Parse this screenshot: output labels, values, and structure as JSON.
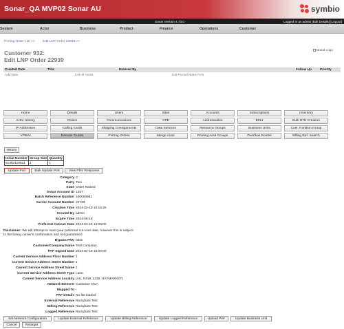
{
  "header": {
    "title": "Sonar_QA MVP02 Sonar AU",
    "logo_text": "symbio",
    "bg_color": "#b32a2e"
  },
  "topbar": {
    "version": "Sonar Version 4.73.0",
    "user_text": "Logged in as admin [Edit Details] [Logout]"
  },
  "menu": [
    "System",
    "Actor",
    "Business",
    "Product",
    "Finance",
    "Operations",
    "Customer"
  ],
  "breadcrumbs": [
    "Porting Order List >>",
    "Edit LNP Order 22939 >>"
  ],
  "page": {
    "title_line1": "Customer 932:",
    "title_line2": "Edit LNP Order 22939",
    "brand_logo_alt": "Brand Logo"
  },
  "notes_grid": {
    "headers": [
      "Created Date",
      "Title",
      "Entered By",
      "Follow Up",
      "Priority"
    ],
    "links": [
      "Add Note",
      "List All Notes",
      "List Pinned Notes First"
    ]
  },
  "nav_buttons": [
    [
      "Home",
      "Details",
      "Users",
      "Sites",
      "Accounts",
      "Subscriptions",
      "Inventory"
    ],
    [
      "Actor History",
      "Orders",
      "Communications",
      "CPE",
      "Addressables",
      "E911",
      "Bulk RTE Creation"
    ],
    [
      "IP Addresses",
      "Calling Cards",
      "Shipping Consignments",
      "Data Services",
      "Resource Groups",
      "Business Units",
      "Cust. Partition Group"
    ],
    [
      "VPBXs",
      "Remote Trunks",
      "Porting Orders",
      "Merge Actor",
      "Routing Area Groups",
      "Overflow Routes",
      "Billing Ref. Search"
    ]
  ],
  "history_button": "History",
  "number_table": {
    "headers": [
      "Initial Number",
      "Group Size",
      "Quantity"
    ],
    "rows": [
      [
        "61352110511",
        "1",
        "1"
      ]
    ]
  },
  "port_buttons": [
    "Update Port",
    "Bulk Update Port",
    "View PNV Response"
  ],
  "details": [
    {
      "label": "Category",
      "value": "C"
    },
    {
      "label": "Party",
      "value": "Two"
    },
    {
      "label": "State",
      "value": "Order Raised"
    },
    {
      "label": "Sonar Account ID",
      "value": "1387"
    },
    {
      "label": "Batch Reference Number",
      "value": "100069951"
    },
    {
      "label": "Carrier Account Number",
      "value": "20733"
    },
    {
      "label": "Creation Time",
      "value": "2024-02-19 10:16:25"
    },
    {
      "label": "Created By",
      "value": "admin"
    },
    {
      "label": "Expire Time",
      "value": "2024-06-18"
    },
    {
      "label": "Preferred Cutover Date",
      "value": "2024-03-13 13:00:00"
    }
  ],
  "disclaimer": {
    "label": "Disclaimer:",
    "text": "We will attempt to meet your preferred cut-over date, however this is subject to the losing carrier's confirmation and not guaranteed"
  },
  "details2": [
    {
      "label": "Bypass PNV",
      "value": "false"
    },
    {
      "label": "Customer/Company Name",
      "value": "Test Company"
    },
    {
      "label": "PAF Signed Date",
      "value": "2024-02-19 15:00:00"
    },
    {
      "label": "Current Service Address Floor Number",
      "value": "1"
    },
    {
      "label": "Current Service Address Street Number",
      "value": "1"
    },
    {
      "label": "Current Service Address Street Name",
      "value": "1"
    },
    {
      "label": "Current Service Address Street Type",
      "value": "Lane"
    },
    {
      "label": "Current Service Address Locality",
      "value": "(AU, NSW, 1238, HAYMARKET)"
    },
    {
      "label": "Network Element",
      "value": "Customer OCA"
    },
    {
      "label": "Mapped To",
      "value": ""
    },
    {
      "label": "PAF Details",
      "value": "No file loaded"
    },
    {
      "label": "External Reference",
      "value": "Rannjhani Test"
    },
    {
      "label": "Billing Reference",
      "value": "Rannjhani Test"
    },
    {
      "label": "Logged Reference",
      "value": "Rannjhani Test"
    }
  ],
  "action_buttons": [
    "Set Network Configuration",
    "Update External Reference",
    "Update Billing Reference",
    "Update Logged Reference",
    "Upload PAF",
    "Update Business Unit"
  ],
  "final_buttons": [
    "Cancel",
    "Retarget"
  ]
}
